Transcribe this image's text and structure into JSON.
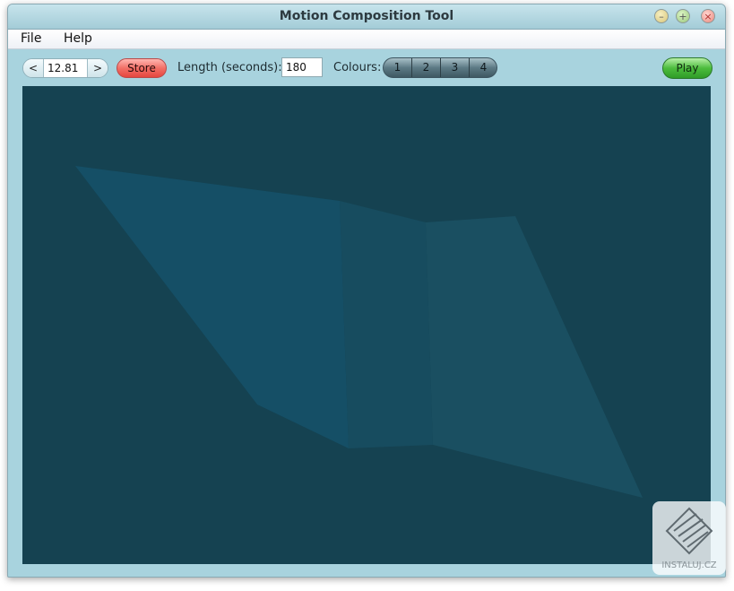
{
  "window": {
    "title": "Motion Composition Tool"
  },
  "menubar": {
    "items": [
      "File",
      "Help"
    ]
  },
  "toolbar": {
    "prev_label": "<",
    "time_value": "12.81",
    "next_label": ">",
    "store_label": "Store",
    "length_label": "Length (seconds):",
    "length_value": "180",
    "colours_label": "Colours:",
    "colour_buttons": [
      "1",
      "2",
      "3",
      "4"
    ],
    "play_label": "Play"
  },
  "canvas": {
    "background_color": "#154251",
    "shape_colors": [
      "#154f66",
      "#174c5f",
      "#1a4f61"
    ]
  },
  "watermark": {
    "text": "INSTALUJ.CZ"
  }
}
